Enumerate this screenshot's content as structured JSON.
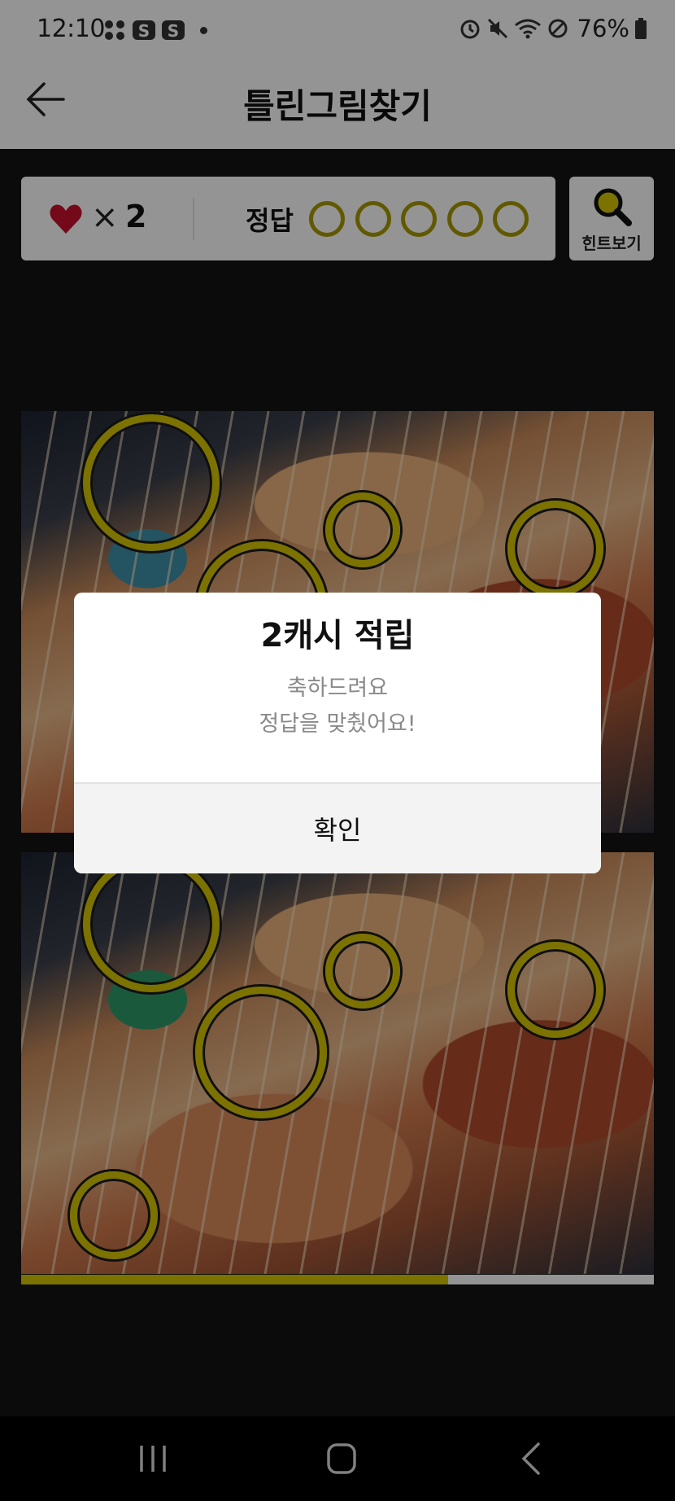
{
  "status_bar": {
    "time": "12:10",
    "battery": "76%"
  },
  "header": {
    "title": "틀린그림찾기",
    "back_icon": "arrow-left-icon"
  },
  "score": {
    "lives_symbol": "×",
    "lives": "2",
    "answers_label": "정답",
    "answer_slots": 5
  },
  "hint": {
    "label": "힌트보기",
    "icon": "magnifier-icon"
  },
  "progress": {
    "fraction": 0.675,
    "fill_color": "#d4c400"
  },
  "modal": {
    "title": "2캐시 적립",
    "message_line1": "축하드려요",
    "message_line2": "정답을 맞췄어요!",
    "confirm_label": "확인"
  },
  "colors": {
    "accent_yellow": "#d6c400",
    "heart_red": "#c8102e"
  },
  "nav": {
    "recents_icon": "recents-icon",
    "home_icon": "home-icon",
    "back_icon": "back-icon"
  }
}
